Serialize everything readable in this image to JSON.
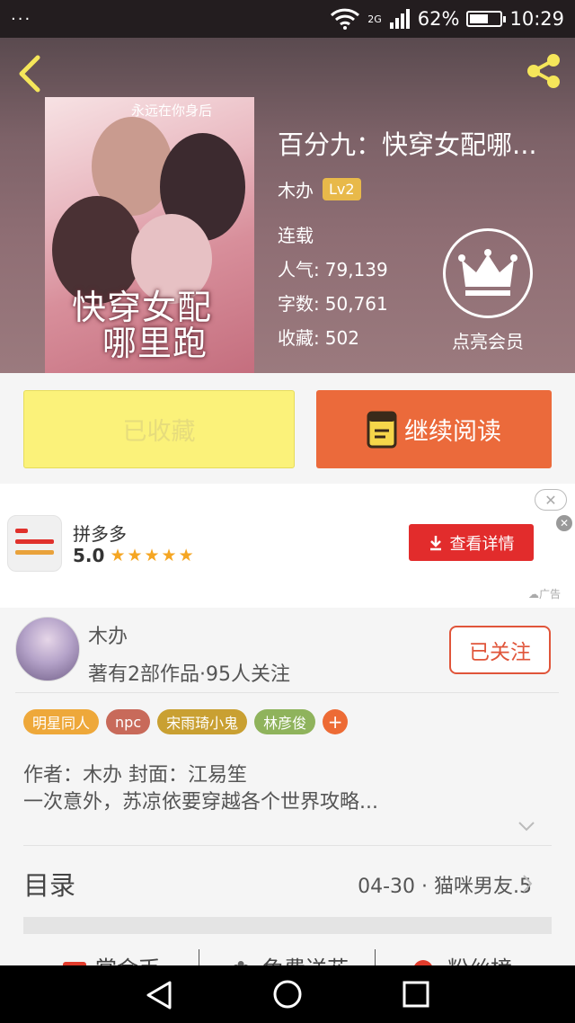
{
  "status_bar": {
    "menu_dots": "···",
    "network": "2G",
    "battery": "62%",
    "battery_level": 0.62,
    "time": "10:29"
  },
  "book": {
    "cover_top_text": "永远在你身后",
    "cover_title_line1": "快穿女配",
    "cover_title_line2": "哪里跑",
    "title": "百分九：快穿女配哪...",
    "author": "木办",
    "level_badge": "Lv2",
    "status": "连载",
    "popularity_label": "人气:",
    "popularity_value": "79,139",
    "wordcount_label": "字数:",
    "wordcount_value": "50,761",
    "favorites_label": "收藏:",
    "favorites_value": "502",
    "vip_label": "点亮会员"
  },
  "actions": {
    "collected_label": "已收藏",
    "continue_reading_label": "继续阅读"
  },
  "ad": {
    "app_name": "拼多多",
    "rating": "5.0",
    "stars": "★★★★★",
    "details_button": "查看详情",
    "ad_label": "广告",
    "close_symbol": "✕"
  },
  "author_section": {
    "name": "木办",
    "info": "著有2部作品·95人关注",
    "follow_button": "已关注"
  },
  "tags": [
    {
      "label": "明星同人",
      "color": "#eea83a"
    },
    {
      "label": "npc",
      "color": "#c86a5a"
    },
    {
      "label": "宋雨琦小鬼",
      "color": "#c9a032"
    },
    {
      "label": "林彦俊",
      "color": "#8fb35c"
    }
  ],
  "tag_add": "+",
  "description": {
    "line1": "作者：木办 封面：江易笙",
    "line2": "一次意外，苏凉依要穿越各个世界攻略..."
  },
  "toc": {
    "label": "目录",
    "latest": "04-30 · 猫咪男友.5"
  },
  "bottom_tabs": [
    "赏金币",
    "免费送花",
    "粉丝榜"
  ],
  "colors": {
    "accent_orange": "#eb6a3b",
    "collected_yellow": "#fbf27a",
    "ad_red": "#e22c2c",
    "level_gold": "#e8b94a"
  }
}
